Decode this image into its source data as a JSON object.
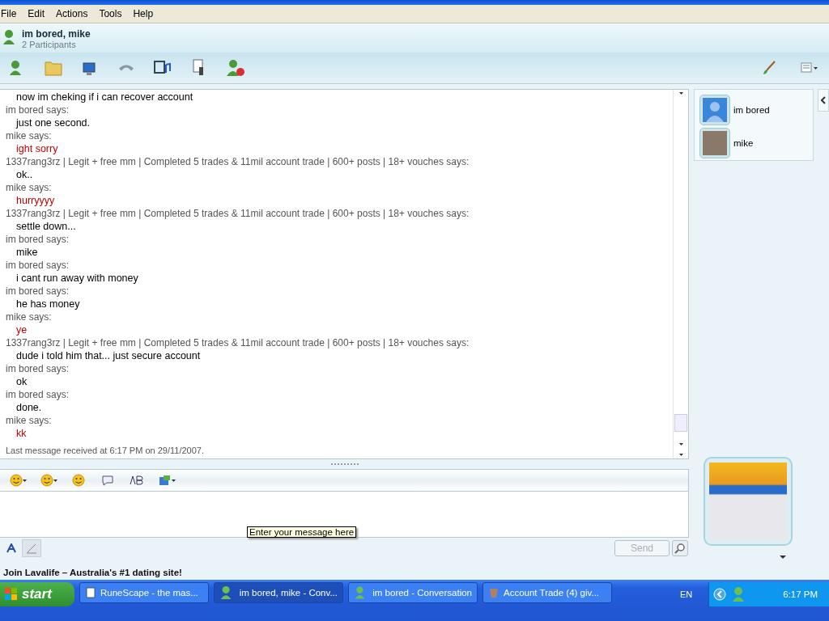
{
  "menu": [
    "File",
    "Edit",
    "Actions",
    "Tools",
    "Help"
  ],
  "conversation": {
    "title": "im bored, mike",
    "subtitle": "2 Participants"
  },
  "lines": [
    {
      "kind": "message",
      "text": "now im cheking if i can recover account",
      "color": "#000000"
    },
    {
      "kind": "sender",
      "text": "im bored says:"
    },
    {
      "kind": "message",
      "text": "just one second.",
      "color": "#000000"
    },
    {
      "kind": "sender",
      "text": "mike says:"
    },
    {
      "kind": "message",
      "text": "ight sorry",
      "color": "#c00000"
    },
    {
      "kind": "sender",
      "text": "1337rang3rz | Legit + free mm | Completed 5 trades & 11mil account trade | 600+ posts | 18+ vouches says:"
    },
    {
      "kind": "message",
      "text": "ok..",
      "color": "#000000"
    },
    {
      "kind": "sender",
      "text": "mike says:"
    },
    {
      "kind": "message",
      "text": "hurryyyy",
      "color": "#c00000"
    },
    {
      "kind": "sender",
      "text": "1337rang3rz | Legit + free mm | Completed 5 trades & 11mil account trade | 600+ posts | 18+ vouches says:"
    },
    {
      "kind": "message",
      "text": "settle down...",
      "color": "#000000"
    },
    {
      "kind": "sender",
      "text": "im bored says:"
    },
    {
      "kind": "message",
      "text": "mike",
      "color": "#000000"
    },
    {
      "kind": "sender",
      "text": "im bored says:"
    },
    {
      "kind": "message",
      "text": "i cant run away with money",
      "color": "#000000"
    },
    {
      "kind": "sender",
      "text": "im bored says:"
    },
    {
      "kind": "message",
      "text": "he has money",
      "color": "#000000"
    },
    {
      "kind": "sender",
      "text": "mike says:"
    },
    {
      "kind": "message",
      "text": "ye",
      "color": "#c00000"
    },
    {
      "kind": "sender",
      "text": "1337rang3rz | Legit + free mm | Completed 5 trades & 11mil account trade | 600+ posts | 18+ vouches says:"
    },
    {
      "kind": "message",
      "text": "dude i told him that... just secure account",
      "color": "#000000"
    },
    {
      "kind": "sender",
      "text": "im bored says:"
    },
    {
      "kind": "message",
      "text": "ok",
      "color": "#000000"
    },
    {
      "kind": "sender",
      "text": "im bored says:"
    },
    {
      "kind": "message",
      "text": "done.",
      "color": "#000000"
    },
    {
      "kind": "sender",
      "text": "mike says:"
    },
    {
      "kind": "message",
      "text": "kk",
      "color": "#c00000"
    }
  ],
  "status": "Last message received at 6:17 PM on 29/11/2007.",
  "participants": [
    {
      "name": "im bored",
      "kind": "default"
    },
    {
      "name": "mike",
      "kind": "photo"
    }
  ],
  "tooltip": "Enter your message here",
  "send": {
    "label": "Send",
    "disabled": true
  },
  "ad": "Join Lavalife – Australia's #1 dating site!",
  "taskbar": {
    "start": "start",
    "items": [
      {
        "label": "RuneScape - the mas...",
        "kind": "browser",
        "selected": false
      },
      {
        "label": "im bored, mike - Conv...",
        "kind": "messenger",
        "selected": true
      },
      {
        "label": "im bored - Conversation",
        "kind": "messenger",
        "selected": false
      },
      {
        "label": "Account Trade (4) giv...",
        "kind": "forum",
        "selected": false
      }
    ],
    "language": "EN",
    "time": "6:17 PM"
  }
}
